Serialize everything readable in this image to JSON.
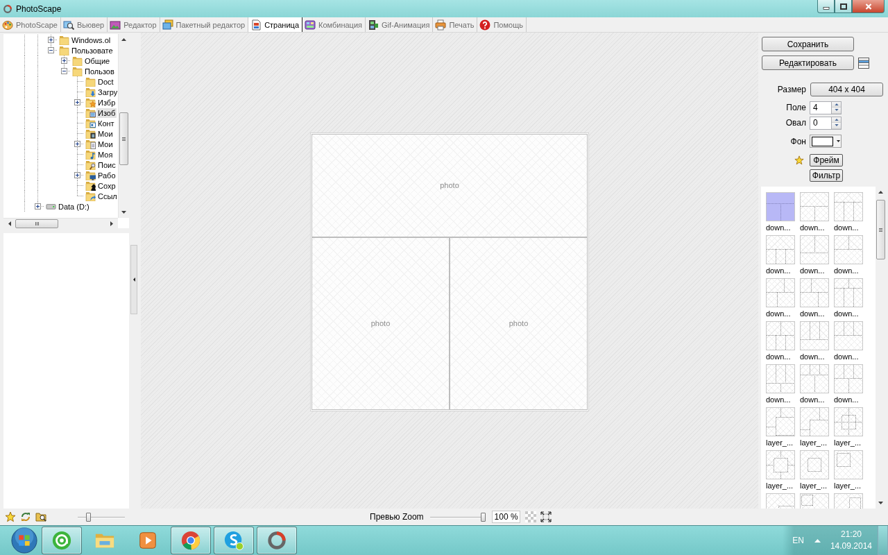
{
  "window": {
    "title": "PhotoScape"
  },
  "tabs": [
    {
      "label": "PhotoScape",
      "kind": "photoscape",
      "selected": false
    },
    {
      "label": "Вьювер",
      "kind": "viewer",
      "selected": false
    },
    {
      "label": "Редактор",
      "kind": "editor",
      "selected": false
    },
    {
      "label": "Пакетный редактор",
      "kind": "batch",
      "selected": false
    },
    {
      "label": "Страница",
      "kind": "page",
      "selected": true
    },
    {
      "label": "Комбинация",
      "kind": "combine",
      "selected": false
    },
    {
      "label": "Gif-Анимация",
      "kind": "gif",
      "selected": false
    },
    {
      "label": "Печать",
      "kind": "print",
      "selected": false
    },
    {
      "label": "Помощь",
      "kind": "help",
      "selected": false
    }
  ],
  "folder_tree": {
    "items": [
      {
        "children": [
          {
            "label": "Windows.ol",
            "kind": "folder",
            "expanded": false,
            "selected": false
          },
          {
            "label": "Пользовате",
            "kind": "folder",
            "expanded": true,
            "selected": false,
            "children": [
              {
                "label": "Общие",
                "kind": "folder",
                "expanded": false,
                "selected": false
              },
              {
                "label": "Пользов",
                "kind": "folder",
                "expanded": true,
                "selected": false,
                "children": [
                  {
                    "label": "Doct",
                    "kind": "folder",
                    "selected": false
                  },
                  {
                    "label": "Загру",
                    "kind": "downloads",
                    "selected": false
                  },
                  {
                    "label": "Избр",
                    "kind": "favorites",
                    "expanded": false,
                    "selected": false
                  },
                  {
                    "label": "Изоб",
                    "kind": "pictures",
                    "selected": true
                  },
                  {
                    "label": "Конт",
                    "kind": "contacts",
                    "selected": false
                  },
                  {
                    "label": "Мои",
                    "kind": "videos",
                    "selected": false
                  },
                  {
                    "label": "Мои",
                    "kind": "documents",
                    "expanded": false,
                    "selected": false
                  },
                  {
                    "label": "Моя",
                    "kind": "music",
                    "selected": false
                  },
                  {
                    "label": "Поис",
                    "kind": "searches",
                    "selected": false
                  },
                  {
                    "label": "Рабо",
                    "kind": "desktop",
                    "expanded": false,
                    "selected": false
                  },
                  {
                    "label": "Сохр",
                    "kind": "games",
                    "selected": false
                  },
                  {
                    "label": "Ссыл",
                    "kind": "links",
                    "selected": false
                  }
                ]
              }
            ]
          }
        ]
      },
      {
        "label": "Data (D:)",
        "kind": "drive",
        "expanded": false,
        "selected": false
      }
    ]
  },
  "page_layout": {
    "cells": [
      {
        "label": "photo"
      },
      {
        "label": "photo"
      },
      {
        "label": "photo"
      }
    ]
  },
  "right_panel": {
    "save_button": "Сохранить",
    "edit_button": "Редактировать",
    "size": {
      "label": "Размер",
      "value": "404 x 404"
    },
    "margin": {
      "label": "Поле",
      "value": "4"
    },
    "oval": {
      "label": "Овал",
      "value": "0"
    },
    "background": {
      "label": "Фон",
      "color": "#ffffff"
    },
    "frame_button": "Фрейм",
    "filter_button": "Фильтр"
  },
  "layouts": {
    "items": [
      {
        "label": "down...",
        "selected": true
      },
      {
        "label": "down...",
        "selected": false
      },
      {
        "label": "down...",
        "selected": false
      },
      {
        "label": "down...",
        "selected": false
      },
      {
        "label": "down...",
        "selected": false
      },
      {
        "label": "down...",
        "selected": false
      },
      {
        "label": "down...",
        "selected": false
      },
      {
        "label": "down...",
        "selected": false
      },
      {
        "label": "down...",
        "selected": false
      },
      {
        "label": "down...",
        "selected": false
      },
      {
        "label": "down...",
        "selected": false
      },
      {
        "label": "down...",
        "selected": false
      },
      {
        "label": "down...",
        "selected": false
      },
      {
        "label": "down...",
        "selected": false
      },
      {
        "label": "down...",
        "selected": false
      },
      {
        "label": "layer_...",
        "selected": false
      },
      {
        "label": "layer_...",
        "selected": false
      },
      {
        "label": "layer_...",
        "selected": false
      },
      {
        "label": "layer_...",
        "selected": false
      },
      {
        "label": "layer_...",
        "selected": false
      },
      {
        "label": "layer_...",
        "selected": false
      },
      {
        "selected": false
      },
      {
        "selected": false
      },
      {
        "selected": false
      }
    ]
  },
  "bottom_bar": {
    "thumb_size_slider": {
      "level": 0.2
    },
    "zoom_label": "Превью Zoom",
    "zoom_slider": {
      "level": 1
    },
    "zoom_value": "100 %"
  },
  "taskbar": {
    "apps": [
      {
        "kind": "mail",
        "running": true
      },
      {
        "kind": "explorer",
        "running": false
      },
      {
        "kind": "media",
        "running": false
      },
      {
        "kind": "browser",
        "running": true
      },
      {
        "kind": "messenger",
        "running": true
      },
      {
        "kind": "photoscape",
        "running": true
      }
    ],
    "language": "EN",
    "time": "21:20",
    "date": "14.09.2014"
  }
}
